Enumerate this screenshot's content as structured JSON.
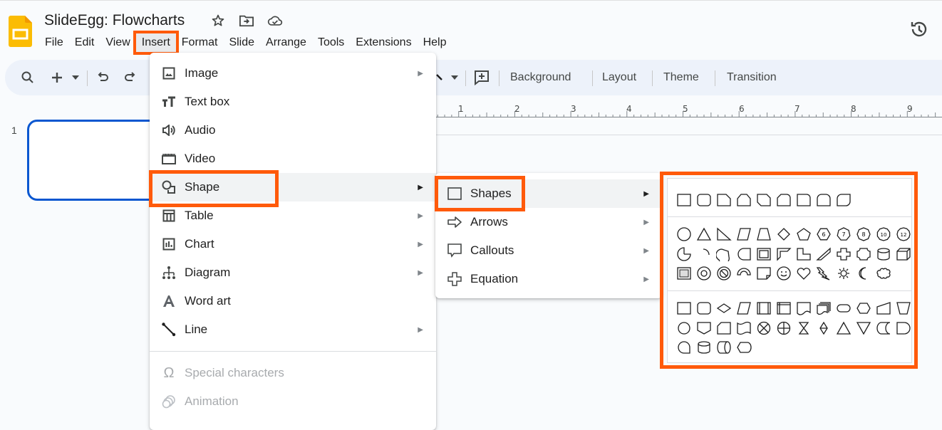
{
  "app": {
    "title": "SlideEgg: Flowcharts",
    "brand_color": "#fbbc04",
    "title_icons": [
      "star-icon",
      "move-to-folder-icon",
      "cloud-saved-icon"
    ],
    "history_icon": "version-history-icon"
  },
  "menubar": [
    "File",
    "Edit",
    "View",
    "Insert",
    "Format",
    "Slide",
    "Arrange",
    "Tools",
    "Extensions",
    "Help"
  ],
  "menubar_active": "Insert",
  "toolbar": {
    "buttons": [
      "Background",
      "Layout",
      "Theme",
      "Transition"
    ],
    "icons": [
      "search-icon",
      "new-slide-icon",
      "dropdown-icon",
      "undo-icon",
      "redo-icon",
      "line-tool-icon",
      "dropdown-icon",
      "comment-add-icon"
    ]
  },
  "ruler": {
    "ticks": [
      "1",
      "2",
      "3",
      "4",
      "5",
      "6",
      "7",
      "8",
      "9"
    ]
  },
  "filmstrip": {
    "slide_number": "1"
  },
  "insert_menu": {
    "items": [
      {
        "label": "Image",
        "icon": "image-icon",
        "submenu": true
      },
      {
        "label": "Text box",
        "icon": "text-box-icon",
        "submenu": false
      },
      {
        "label": "Audio",
        "icon": "audio-icon",
        "submenu": false
      },
      {
        "label": "Video",
        "icon": "video-icon",
        "submenu": false
      },
      {
        "label": "Shape",
        "icon": "shape-icon",
        "submenu": true,
        "highlighted": true
      },
      {
        "label": "Table",
        "icon": "table-icon",
        "submenu": true
      },
      {
        "label": "Chart",
        "icon": "chart-icon",
        "submenu": true
      },
      {
        "label": "Diagram",
        "icon": "diagram-icon",
        "submenu": true
      },
      {
        "label": "Word art",
        "icon": "word-art-icon",
        "submenu": false
      },
      {
        "label": "Line",
        "icon": "line-icon",
        "submenu": true
      }
    ],
    "disabled_items": [
      {
        "label": "Special characters",
        "icon": "omega-icon"
      },
      {
        "label": "Animation",
        "icon": "animation-icon"
      }
    ]
  },
  "shape_menu": {
    "items": [
      {
        "label": "Shapes",
        "icon": "square-icon",
        "highlighted": true
      },
      {
        "label": "Arrows",
        "icon": "arrow-icon"
      },
      {
        "label": "Callouts",
        "icon": "callout-icon"
      },
      {
        "label": "Equation",
        "icon": "plus-icon"
      }
    ]
  },
  "shapes_panel": {
    "rectangles": [
      "rectangle",
      "rounded-rectangle",
      "snip-single-corner",
      "snip-same-side",
      "snip-diagonal",
      "snip-round-single",
      "round-single-corner",
      "round-same-side",
      "round-diagonal"
    ],
    "basic_shapes": [
      [
        "ellipse",
        "triangle",
        "right-triangle",
        "parallelogram",
        "trapezoid",
        "diamond",
        "pentagon",
        "hexagon-6",
        "heptagon-7",
        "octagon-8",
        "decagon-10",
        "dodecagon-12"
      ],
      [
        "pie",
        "arc",
        "teardrop",
        "chord",
        "frame",
        "half-frame",
        "l-shape",
        "diagonal-stripe",
        "cross",
        "plaque",
        "can",
        "cube"
      ],
      [
        "bevel",
        "donut",
        "no-symbol",
        "block-arc",
        "folded-corner",
        "smiley",
        "heart",
        "lightning-bolt",
        "sun",
        "moon",
        "cloud"
      ]
    ],
    "flowchart": [
      [
        "process",
        "alternate-process",
        "decision",
        "data",
        "predefined-process",
        "internal-storage",
        "document",
        "multidocument",
        "terminator",
        "preparation",
        "manual-input",
        "manual-operation"
      ],
      [
        "connector",
        "off-page-connector",
        "card",
        "punched-tape",
        "summing-junction",
        "or",
        "collate",
        "sort",
        "extract",
        "merge",
        "stored-data",
        "delay"
      ],
      [
        "sequential-access-storage",
        "magnetic-disk",
        "direct-access-storage",
        "display"
      ]
    ],
    "hexagon_labels": [
      "6",
      "7",
      "8",
      "10",
      "12"
    ]
  },
  "annotation_color": "#ff5a0a"
}
